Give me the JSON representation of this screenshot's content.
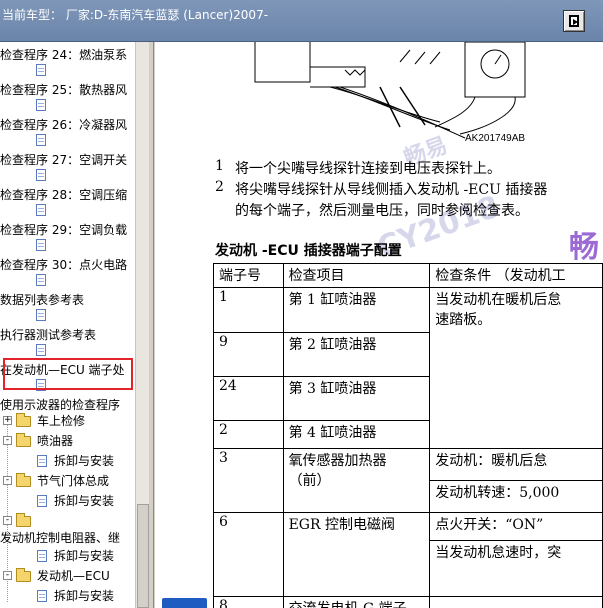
{
  "window": {
    "title": "当前车型：  厂家:D-东南汽车蓝瑟 (Lancer)2007-"
  },
  "tree": {
    "items": [
      {
        "label": "检查程序 24：燃油泵系"
      },
      {
        "label": "检查程序 25：散热器风"
      },
      {
        "label": "检查程序 26：冷凝器风"
      },
      {
        "label": "检查程序 27：空调开关"
      },
      {
        "label": "检查程序 28：空调压缩"
      },
      {
        "label": "检查程序 29：空调负载"
      },
      {
        "label": "检查程序 30：点火电路"
      },
      {
        "label": "数据列表参考表"
      },
      {
        "label": "执行器测试参考表"
      },
      {
        "label": "在发动机—ECU 端子处"
      },
      {
        "label": "使用示波器的检查程序"
      }
    ],
    "folders": [
      {
        "label": "车上检修",
        "expander": "+"
      },
      {
        "label": "喷油器",
        "expander": "-",
        "child": "拆卸与安装"
      },
      {
        "label": "节气门体总成",
        "expander": "-",
        "child": "拆卸与安装"
      },
      {
        "label": "",
        "expander": "-"
      },
      {
        "label": "发动机控制电阻器、继",
        "child": "拆卸与安装"
      },
      {
        "label": "发动机—ECU",
        "expander": "-",
        "child": "拆卸与安装"
      }
    ]
  },
  "content": {
    "diagram_label": "AK201749AB",
    "steps": [
      {
        "num": "1",
        "text": "将一个尖嘴导线探针连接到电压表探针上。"
      },
      {
        "num": "2",
        "text": "将尖嘴导线探针从导线侧插入发动机 -ECU 插接器"
      },
      {
        "num": "",
        "text": "的每个端子，然后测量电压，同时参阅检查表。"
      }
    ],
    "section_title": "发动机 -ECU 插接器端子配置",
    "table": {
      "headers": [
        "端子号",
        "检查项目",
        "检查条件 （发动机工"
      ],
      "rows": [
        {
          "pin": "1",
          "item": "第 1 缸喷油器",
          "cond": [
            "当发动机在暖机后怠",
            "速踏板。"
          ]
        },
        {
          "pin": "9",
          "item": "第 2 缸喷油器",
          "cond": []
        },
        {
          "pin": "24",
          "item": "第 3 缸喷油器",
          "cond": []
        },
        {
          "pin": "2",
          "item": "第 4 缸喷油器",
          "cond": []
        },
        {
          "pin": "3",
          "item": "氧传感器加热器",
          "item2": "（前）",
          "cond": [
            "发动机：暖机后怠",
            "发动机转速：5,000"
          ]
        },
        {
          "pin": "6",
          "item": "EGR 控制电磁阀",
          "cond": [
            "点火开关：“ON”",
            "当发动机怠速时，突"
          ]
        },
        {
          "pin": "8",
          "item": "交流发电机 G 端子",
          "cond": []
        }
      ]
    },
    "watermark": {
      "line1": "畅易",
      "line2": "CY2018",
      "big": "畅"
    }
  }
}
